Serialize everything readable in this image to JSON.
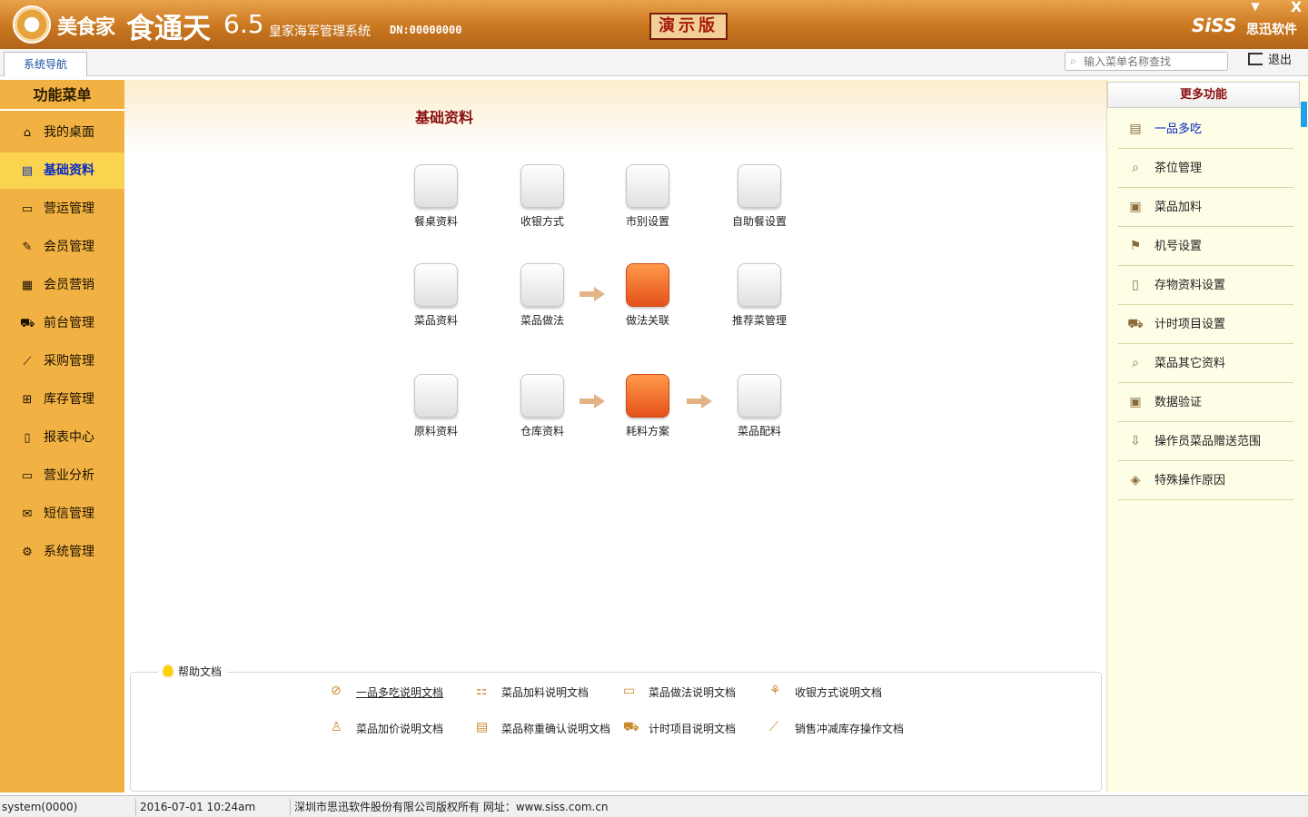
{
  "titlebar": {
    "brand_main": "美食家",
    "brand_sub": "食通天",
    "version": "6.5",
    "system_name": "皇家海军管理系统",
    "dn": "DN:00000000",
    "demo_badge": "演示版",
    "siss_logo": "SiSS",
    "siss_cn": "思迅软件",
    "minimize": "▼",
    "close": "X"
  },
  "tabs": {
    "nav_label": "系统导航"
  },
  "search": {
    "placeholder": "输入菜单名称查找"
  },
  "logout_label": "退出",
  "sidebar": {
    "title": "功能菜单",
    "items": [
      {
        "label": "我的桌面",
        "icon": "⌂"
      },
      {
        "label": "基础资料",
        "icon": "▤"
      },
      {
        "label": "营运管理",
        "icon": "▭"
      },
      {
        "label": "会员管理",
        "icon": "✎"
      },
      {
        "label": "会员营销",
        "icon": "▦"
      },
      {
        "label": "前台管理",
        "icon": "⛟"
      },
      {
        "label": "采购管理",
        "icon": "⟋"
      },
      {
        "label": "库存管理",
        "icon": "⊞"
      },
      {
        "label": "报表中心",
        "icon": "▯"
      },
      {
        "label": "营业分析",
        "icon": "▭"
      },
      {
        "label": "短信管理",
        "icon": "✉"
      },
      {
        "label": "系统管理",
        "icon": "⚙"
      }
    ]
  },
  "main": {
    "section_title": "基础资料",
    "functions": [
      {
        "label": "餐桌资料",
        "glyph": "📋"
      },
      {
        "label": "收银方式",
        "glyph": "▤"
      },
      {
        "label": "市别设置",
        "glyph": "▤"
      },
      {
        "label": "自助餐设置",
        "glyph": "👤"
      },
      {
        "label": "菜品资料",
        "glyph": "▥"
      },
      {
        "label": "菜品做法",
        "glyph": "▣"
      },
      {
        "label": "做法关联",
        "glyph": "▤"
      },
      {
        "label": "推荐菜管理",
        "glyph": "✓"
      },
      {
        "label": "原料资料",
        "glyph": "⛒"
      },
      {
        "label": "仓库资料",
        "glyph": "⚙"
      },
      {
        "label": "耗料方案",
        "glyph": "➔"
      },
      {
        "label": "菜品配料",
        "glyph": "▤"
      }
    ]
  },
  "help": {
    "title": "帮助文档",
    "docs": [
      {
        "label": "一品多吃说明文档",
        "icon": "⊘"
      },
      {
        "label": "菜品加料说明文档",
        "icon": "⚏"
      },
      {
        "label": "菜品做法说明文档",
        "icon": "▭"
      },
      {
        "label": "收银方式说明文档",
        "icon": "⚘"
      },
      {
        "label": "菜品加价说明文档",
        "icon": "♙"
      },
      {
        "label": "菜品称重确认说明文档",
        "icon": "▤"
      },
      {
        "label": "计时项目说明文档",
        "icon": "⛟"
      },
      {
        "label": "销售冲减库存操作文档",
        "icon": "⟋"
      }
    ]
  },
  "right_panel": {
    "title": "更多功能",
    "items": [
      {
        "label": "一品多吃",
        "icon": "▤"
      },
      {
        "label": "茶位管理",
        "icon": "⌕"
      },
      {
        "label": "菜品加料",
        "icon": "▣"
      },
      {
        "label": "机号设置",
        "icon": "⚑"
      },
      {
        "label": "存物资料设置",
        "icon": "▯"
      },
      {
        "label": "计时项目设置",
        "icon": "⛟"
      },
      {
        "label": "菜品其它资料",
        "icon": "⌕"
      },
      {
        "label": "数据验证",
        "icon": "▣"
      },
      {
        "label": "操作员菜品赠送范围",
        "icon": "⇩"
      },
      {
        "label": "特殊操作原因",
        "icon": "◈"
      }
    ]
  },
  "status": {
    "user": "system(0000)",
    "datetime": "2016-07-01 10:24am",
    "copyright": "深圳市思迅软件股份有限公司版权所有 网址：www.siss.com.cn"
  }
}
